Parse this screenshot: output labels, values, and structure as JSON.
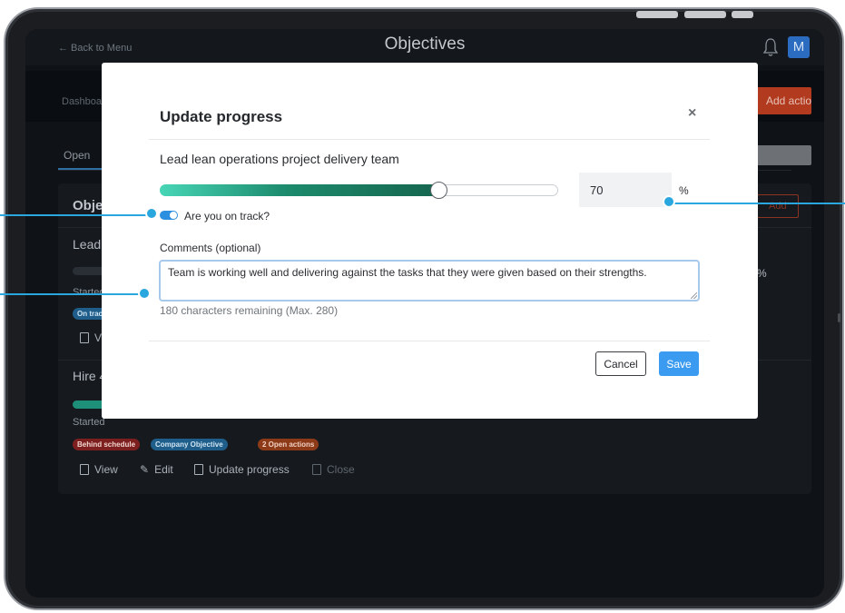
{
  "app": {
    "back_link": "← Back to Menu",
    "title": "Objectives",
    "avatar_initial": "M",
    "subnav_label": "Dashboa",
    "add_action_label": "Add action",
    "tab_open": "Open",
    "panel_header": "Objec",
    "panel_add_label": "Add"
  },
  "objectives": [
    {
      "title": "Lead l",
      "started": "Started",
      "percent": "0 %",
      "badge": "On trac",
      "view": "Vi"
    },
    {
      "title": "Hire 4",
      "started": "Started",
      "badges": [
        "Behind schedule",
        "Company Objective",
        "2 Open actions"
      ],
      "actions": [
        "View",
        "Edit",
        "Update progress",
        "Close"
      ]
    }
  ],
  "modal": {
    "title": "Update progress",
    "close_glyph": "×",
    "objective_name": "Lead lean operations project delivery team",
    "progress_value": "70",
    "progress_fraction": 0.7,
    "percent_suffix": "%",
    "on_track_label": "Are you on track?",
    "on_track": true,
    "comments_label": "Comments (optional)",
    "comments_value": "Team is working well and delivering against the tasks that they were given based on their strengths.",
    "char_count": "180 characters remaining (Max. 280)",
    "cancel_label": "Cancel",
    "save_label": "Save"
  },
  "colors": {
    "accent": "#3b9bf0",
    "callout": "#2ba7df",
    "slider_start": "#47d6b6",
    "slider_end": "#15664e",
    "danger": "#b23a1e"
  },
  "icons": [
    "bell-icon",
    "close-icon",
    "document-icon",
    "pencil-icon",
    "update-icon",
    "close-doc-icon"
  ]
}
